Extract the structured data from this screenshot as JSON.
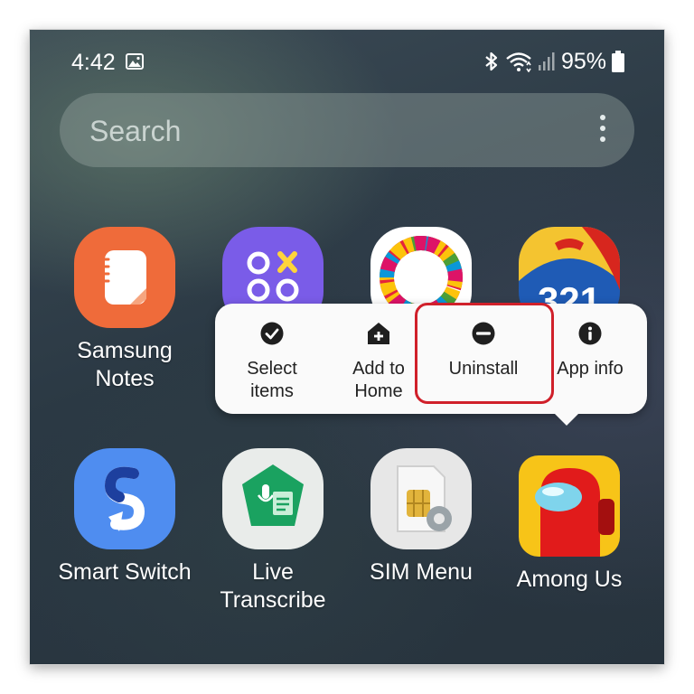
{
  "status_bar": {
    "time": "4:42",
    "battery": "95%",
    "icons": [
      "gallery-icon",
      "bluetooth-icon",
      "wifi-icon",
      "signal-icon",
      "battery-icon"
    ]
  },
  "search": {
    "placeholder": "Search"
  },
  "apps": [
    {
      "label": "Samsung Notes",
      "icon": "samsung-notes-icon",
      "color": "#ef6b3a"
    },
    {
      "label": "",
      "icon": "game-launcher-icon",
      "color": "#7a5ce8"
    },
    {
      "label": "",
      "icon": "sdg-wheel-icon",
      "color": "#ffffff"
    },
    {
      "label": "",
      "icon": "321-app-icon",
      "color": "#1f5bb5"
    },
    {
      "label": "Smart Switch",
      "icon": "smart-switch-icon",
      "color": "#4f8df0"
    },
    {
      "label": "Live Transcribe",
      "icon": "live-transcribe-icon",
      "color": "#1aa260"
    },
    {
      "label": "SIM Menu",
      "icon": "sim-menu-icon",
      "color": "#d9d9d9"
    },
    {
      "label": "Among Us",
      "icon": "among-us-icon",
      "color": "#e11b1b"
    }
  ],
  "context_menu": {
    "items": [
      {
        "label": "Select items",
        "icon": "checkmark-circle-icon"
      },
      {
        "label": "Add to Home",
        "icon": "add-home-icon"
      },
      {
        "label": "Uninstall",
        "icon": "minus-circle-icon"
      },
      {
        "label": "App info",
        "icon": "info-circle-icon"
      }
    ],
    "highlighted": "Uninstall",
    "highlight_color": "#d0202a"
  }
}
